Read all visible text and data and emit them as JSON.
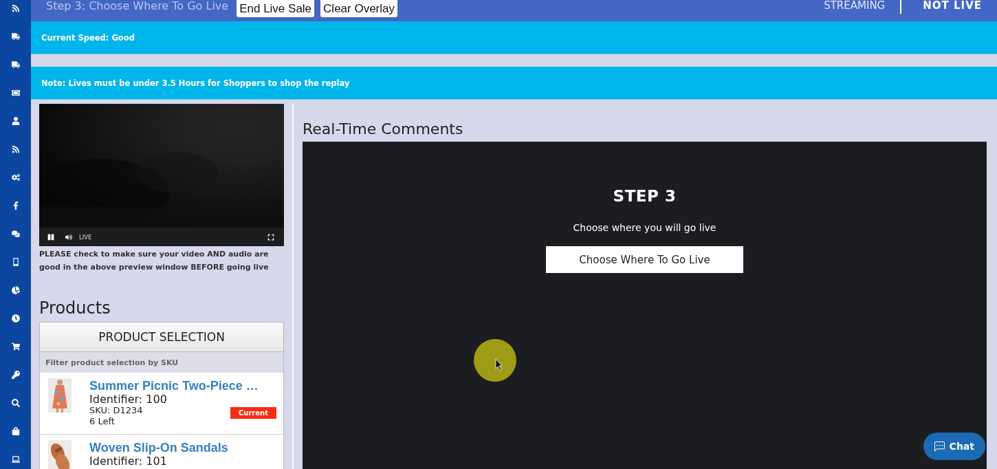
{
  "top_bar": {
    "step_label": "Step 3: Choose Where To Go Live",
    "buttons": [
      "End Live Sale",
      "Clear Overlay"
    ],
    "streaming_label": "STREAMING",
    "live_status": "NOT LIVE"
  },
  "speed_banner": "Current Speed: Good",
  "note_banner": "Note: Lives must be under 3.5 Hours for Shoppers to shop the replay",
  "video_preview": {
    "live_label": "LIVE",
    "notice": "PLEASE check to make sure your video AND audio are good in the above preview window BEFORE going live"
  },
  "products": {
    "title": "Products",
    "selection_button": "PRODUCT SELECTION",
    "filter_placeholder": "Filter product selection by SKU",
    "items": [
      {
        "name": "Summer Picnic Two-Piece …",
        "identifier": "Identifier: 100",
        "sku": "SKU: D1234",
        "stock": "6 Left",
        "badge": "Current",
        "kind": "dress"
      },
      {
        "name": "Woven Slip-On Sandals",
        "identifier": "Identifier: 101",
        "kind": "sandals"
      }
    ]
  },
  "comments": {
    "title": "Real-Time Comments",
    "step_title": "STEP 3",
    "step_text": "Choose where you will go live",
    "step_button": "Choose Where To Go Live"
  },
  "chat_button": "Chat"
}
